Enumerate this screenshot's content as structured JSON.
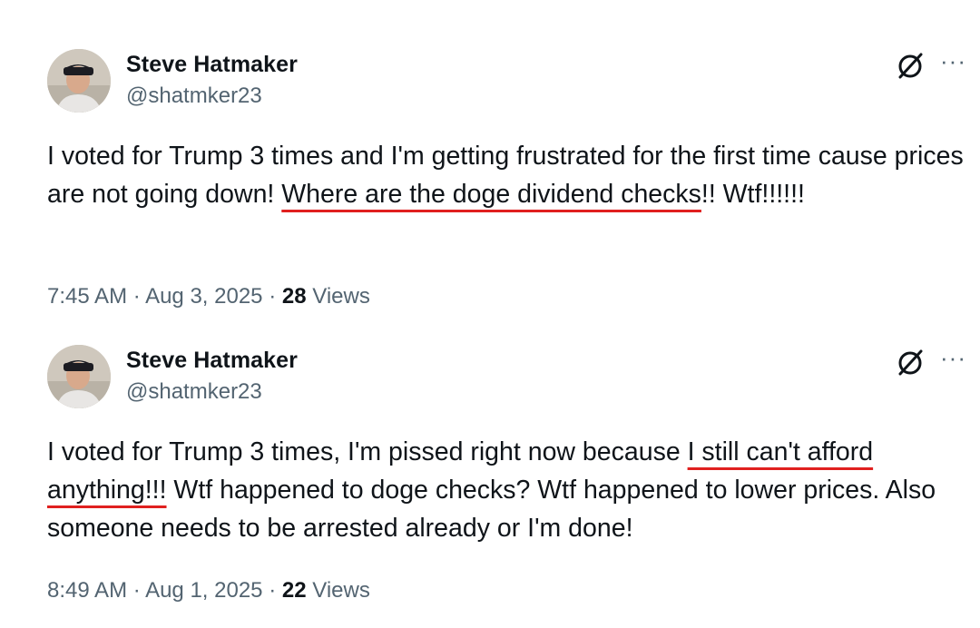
{
  "tweets": [
    {
      "author_name": "Steve Hatmaker",
      "handle": "@shatmker23",
      "text_before": "I voted for Trump 3 times and I'm getting frustrated for the first time cause prices are not going down! ",
      "text_underlined": "Where are the doge dividend checks",
      "text_after": "!! Wtf!!!!!!",
      "time": "7:45 AM",
      "date": "Aug 3, 2025",
      "views_count": "28",
      "views_label": "Views",
      "separator": "·"
    },
    {
      "author_name": "Steve Hatmaker",
      "handle": "@shatmker23",
      "text_before": "I voted for Trump 3 times, I'm pissed right now because ",
      "text_underlined": "I still can't afford anything!!!",
      "text_after": " Wtf happened to doge checks? Wtf happened to lower prices. Also someone needs to be arrested already or I'm done!",
      "time": "8:49 AM",
      "date": "Aug 1, 2025",
      "views_count": "22",
      "views_label": "Views",
      "separator": "·"
    }
  ],
  "icons": {
    "grok": "grok-icon",
    "more": "more-options-icon",
    "more_glyph": "···"
  },
  "colors": {
    "underline": "#e0201f",
    "secondary_text": "#536471",
    "primary_text": "#0f1419"
  }
}
